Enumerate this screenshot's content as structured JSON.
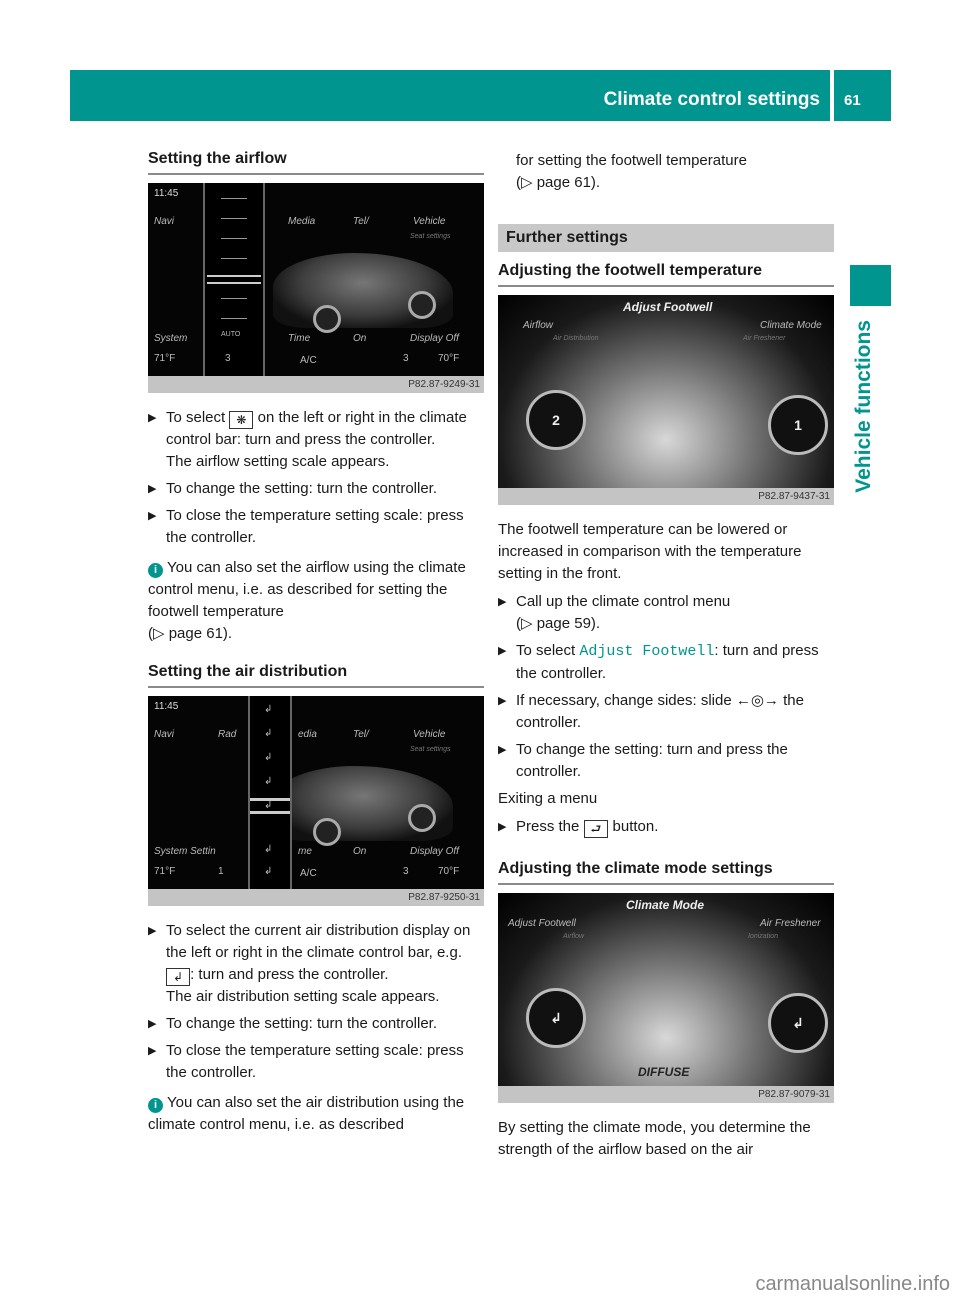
{
  "header": {
    "section_title": "Climate control settings",
    "page_number": "61",
    "chapter_tab": "Vehicle functions",
    "accent_color": "#00968f"
  },
  "col1": {
    "airflow": {
      "heading": "Setting the airflow",
      "screenshot": {
        "time": "11:45",
        "menu": [
          "Navi",
          "Media",
          "Tel/",
          "Vehicle"
        ],
        "sub": "Seat settings",
        "bottom_menu": [
          "System",
          "Time",
          "On",
          "Display Off"
        ],
        "bar_auto": "AUTO",
        "left_temp": "71°F",
        "fan_left": "3",
        "ac": "A/C",
        "fan_right": "3",
        "right_temp": "70°F",
        "code": "P82.87-9249-31"
      },
      "step1_pre": "To select",
      "step1_icon": "fan-icon",
      "step1_post": "on the left or right in the climate control bar: turn and press the controller.",
      "step1_result": "The airflow setting scale appears.",
      "step2": "To change the setting: turn the controller.",
      "step3": "To close the temperature setting scale: press the controller.",
      "note": "You can also set the airflow using the climate control menu, i.e. as described for setting the footwell temperature",
      "note_ref": "(▷ page 61)."
    },
    "air_distribution": {
      "heading": "Setting the air distribution",
      "screenshot": {
        "time": "11:45",
        "menu": [
          "Navi",
          "Rad",
          "edia",
          "Tel/",
          "Vehicle"
        ],
        "sub": "Seat settings",
        "bottom_menu": [
          "System Settin",
          "me",
          "On",
          "Display Off"
        ],
        "left_temp": "71°F",
        "fan_left": "1",
        "ac": "A/C",
        "fan_right": "3",
        "right_temp": "70°F",
        "code": "P82.87-9250-31"
      },
      "step1_pre": "To select the current air distribution display on the left or right in the climate control bar, e.g.",
      "step1_post": ": turn and press the controller.",
      "step1_result": "The air distribution setting scale appears.",
      "step2": "To change the setting: turn the controller.",
      "step3": "To close the temperature setting scale: press the controller.",
      "note": "You can also set the air distribution using the climate control menu, i.e. as described"
    }
  },
  "col2": {
    "continued_text": "for setting the footwell temperature",
    "continued_ref": "(▷ page 61).",
    "further_settings": "Further settings",
    "footwell": {
      "heading": "Adjusting the footwell temperature",
      "screenshot": {
        "title": "Adjust Footwell",
        "left": "Airflow",
        "left_sub": "Air Distribution",
        "right": "Climate Mode",
        "right_sub": "Air Freshener",
        "dial_left": "2",
        "dial_right": "1",
        "code": "P82.87-9437-31"
      },
      "intro": "The footwell temperature can be lowered or increased in comparison with the temperature setting in the front.",
      "step1": "Call up the climate control menu",
      "step1_ref": "(▷ page 59).",
      "step2_pre": "To select",
      "step2_menu": "Adjust Footwell",
      "step2_post": ": turn and press the controller.",
      "step3": "If necessary, change sides: slide ←◎→ the controller.",
      "step4": "To change the setting: turn and press the controller.",
      "exit_label": "Exiting a menu",
      "exit_step_pre": "Press the",
      "exit_step_post": "button."
    },
    "climate_mode": {
      "heading": "Adjusting the climate mode settings",
      "screenshot": {
        "title": "Climate Mode",
        "left": "Adjust Footwell",
        "left_sub": "Airflow",
        "right": "Air Freshener",
        "right_sub": "Ionization",
        "mode": "DIFFUSE",
        "code": "P82.87-9079-31"
      },
      "text": "By setting the climate mode, you determine the strength of the airflow based on the air"
    }
  },
  "watermark": "carmanualsonline.info"
}
